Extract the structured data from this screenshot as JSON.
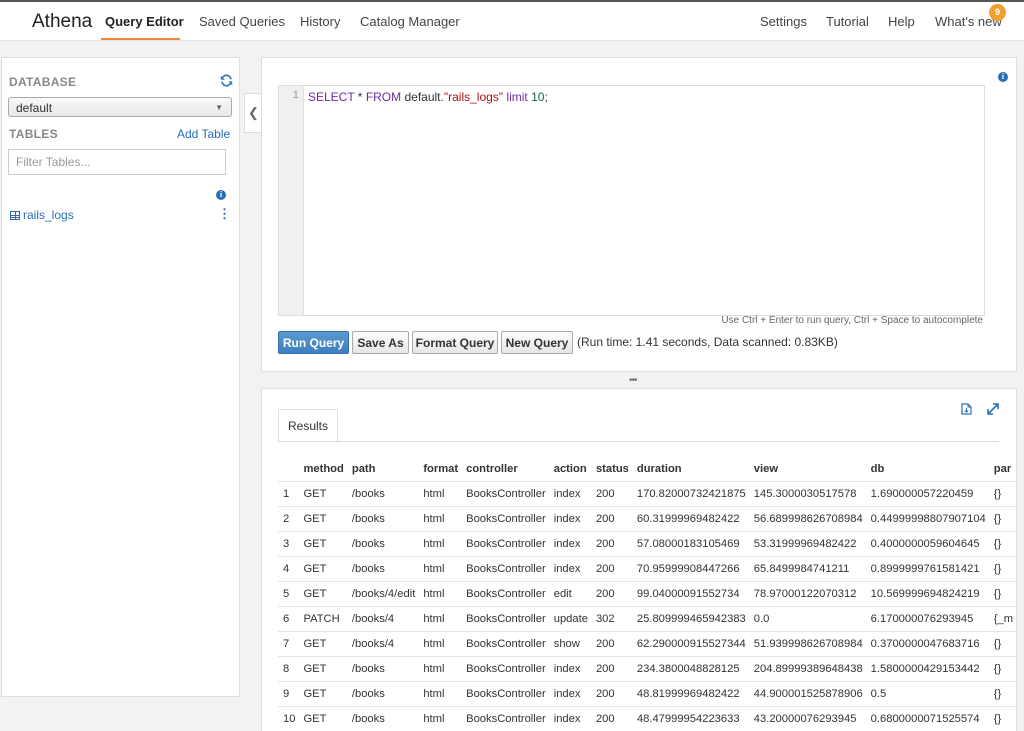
{
  "nav": {
    "brand": "Athena",
    "items": [
      "Query Editor",
      "Saved Queries",
      "History",
      "Catalog Manager"
    ],
    "right_items": [
      "Settings",
      "Tutorial",
      "Help",
      "What's new"
    ],
    "whats_new_count": "9",
    "accent_color": "#f58536"
  },
  "sidebar": {
    "database_heading": "DATABASE",
    "database_value": "default",
    "tables_heading": "TABLES",
    "add_table": "Add Table",
    "filter_placeholder": "Filter Tables...",
    "tables": [
      "rails_logs"
    ]
  },
  "editor": {
    "line_number": "1",
    "query": "SELECT * FROM default.\"rails_logs\" limit 10;",
    "hint": "Use Ctrl + Enter to run query, Ctrl + Space to autocomplete",
    "buttons": {
      "run": "Run Query",
      "save_as": "Save As",
      "format": "Format Query",
      "new": "New Query"
    },
    "run_info": "(Run time: 1.41 seconds, Data scanned: 0.83KB)"
  },
  "results": {
    "tab_label": "Results",
    "columns": [
      "",
      "method",
      "path",
      "format",
      "controller",
      "action",
      "status",
      "duration",
      "view",
      "db",
      "par"
    ],
    "rows": [
      [
        "1",
        "GET",
        "/books",
        "html",
        "BooksController",
        "index",
        "200",
        "170.82000732421875",
        "145.3000030517578",
        "1.690000057220459",
        "{}"
      ],
      [
        "2",
        "GET",
        "/books",
        "html",
        "BooksController",
        "index",
        "200",
        "60.31999969482422",
        "56.689998626708984",
        "0.44999998807907104",
        "{}"
      ],
      [
        "3",
        "GET",
        "/books",
        "html",
        "BooksController",
        "index",
        "200",
        "57.08000183105469",
        "53.31999969482422",
        "0.4000000059604645",
        "{}"
      ],
      [
        "4",
        "GET",
        "/books",
        "html",
        "BooksController",
        "index",
        "200",
        "70.95999908447266",
        "65.8499984741211",
        "0.8999999761581421",
        "{}"
      ],
      [
        "5",
        "GET",
        "/books/4/edit",
        "html",
        "BooksController",
        "edit",
        "200",
        "99.04000091552734",
        "78.97000122070312",
        "10.569999694824219",
        "{}"
      ],
      [
        "6",
        "PATCH",
        "/books/4",
        "html",
        "BooksController",
        "update",
        "302",
        "25.809999465942383",
        "0.0",
        "6.170000076293945",
        "{_m"
      ],
      [
        "7",
        "GET",
        "/books/4",
        "html",
        "BooksController",
        "show",
        "200",
        "62.290000915527344",
        "51.939998626708984",
        "0.3700000047683716",
        "{}"
      ],
      [
        "8",
        "GET",
        "/books",
        "html",
        "BooksController",
        "index",
        "200",
        "234.3800048828125",
        "204.89999389648438",
        "1.5800000429153442",
        "{}"
      ],
      [
        "9",
        "GET",
        "/books",
        "html",
        "BooksController",
        "index",
        "200",
        "48.81999969482422",
        "44.900001525878906",
        "0.5",
        "{}"
      ],
      [
        "10",
        "GET",
        "/books",
        "html",
        "BooksController",
        "index",
        "200",
        "48.47999954223633",
        "43.20000076293945",
        "0.6800000071525574",
        "{}"
      ]
    ]
  }
}
